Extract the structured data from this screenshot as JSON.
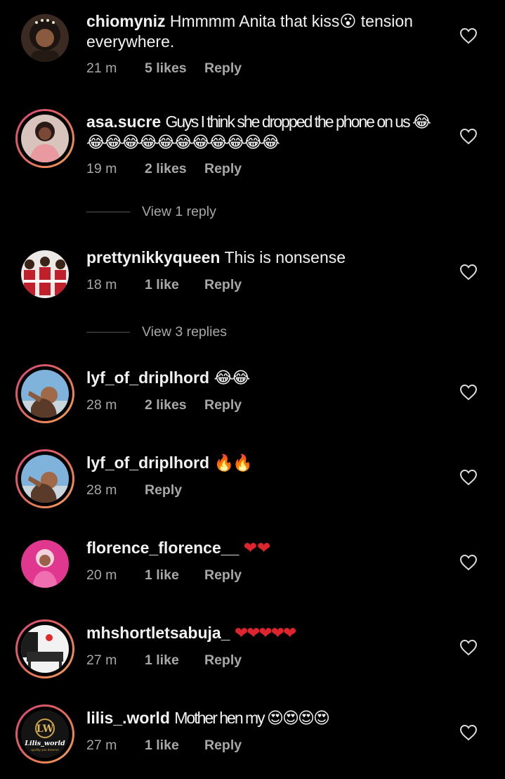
{
  "comments": [
    {
      "username": "chiomyniz",
      "text": "Hmmmm Anita that kiss😮 tension everywhere.",
      "time": "21 m",
      "likes": "5 likes",
      "reply": "Reply",
      "avatar": "woman-portrait",
      "story_ring": false
    },
    {
      "username": "asa.sucre",
      "text": "Guys I think she dropped the phone on us 😂😂😂😂😂😂😂😂😂😂😂😂",
      "time": "19 m",
      "likes": "2 likes",
      "reply": "Reply",
      "avatar": "woman-pink-outfit",
      "story_ring": true
    },
    {
      "username": "prettynikkyqueen",
      "text": "This is nonsense",
      "time": "18 m",
      "likes": "1 like",
      "reply": "Reply",
      "avatar": "three-women-red",
      "story_ring": false
    },
    {
      "username": "lyf_of_driplhord",
      "text": "😂😂",
      "time": "28 m",
      "likes": "2 likes",
      "reply": "Reply",
      "avatar": "man-sky",
      "story_ring": true
    },
    {
      "username": "lyf_of_driplhord",
      "text": "🔥🔥",
      "time": "28 m",
      "likes": "",
      "reply": "Reply",
      "avatar": "man-sky",
      "story_ring": true
    },
    {
      "username": "florence_florence__",
      "text": "❤❤",
      "time": "20 m",
      "likes": "1 like",
      "reply": "Reply",
      "avatar": "woman-pink-bg",
      "story_ring": false
    },
    {
      "username": "mhshortletsabuja_",
      "text": "❤❤❤❤❤",
      "time": "27 m",
      "likes": "1 like",
      "reply": "Reply",
      "avatar": "apartment-interior",
      "story_ring": true
    },
    {
      "username": "lilis_.world",
      "text": "Mother hen my 😍😍😍😍",
      "time": "27 m",
      "likes": "1 like",
      "reply": "Reply",
      "avatar": "lilis-world-logo",
      "story_ring": true
    }
  ],
  "view_replies": [
    {
      "label": "View 1 reply"
    },
    {
      "label": "View 3 replies"
    }
  ],
  "logo_text": {
    "initials": "LW",
    "name": "Lilis_world",
    "tagline": "quality you deserve"
  },
  "colors": {
    "background": "#000000",
    "text": "#f2f2f2",
    "muted": "#a8a8a8",
    "story_ring": [
      "#d9467a",
      "#f0a35a"
    ]
  }
}
